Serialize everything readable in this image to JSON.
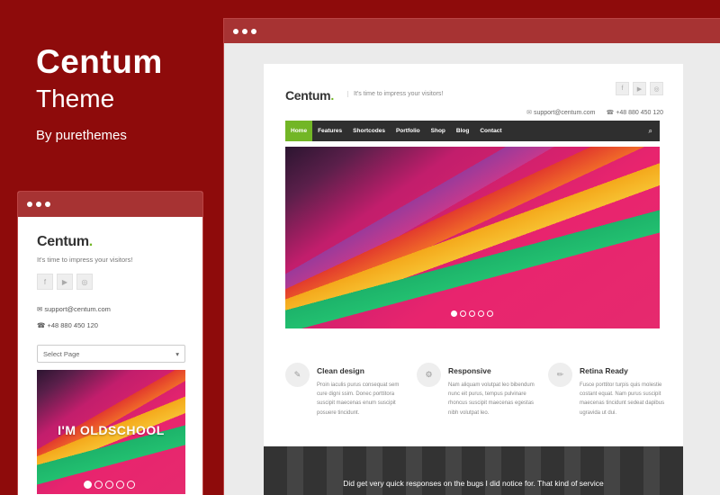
{
  "promo": {
    "title": "Centum",
    "subtitle": "Theme",
    "byline": "By purethemes"
  },
  "desktop": {
    "logo": "Centum",
    "logo_dot": ".",
    "tagline": "It's time to impress your visitors!",
    "social": [
      "f",
      "▶",
      "◎"
    ],
    "email": "support@centum.com",
    "phone": "+48 880 450 120",
    "nav": {
      "items": [
        {
          "label": "Home",
          "active": true
        },
        {
          "label": "Features"
        },
        {
          "label": "Shortcodes"
        },
        {
          "label": "Portfolio"
        },
        {
          "label": "Shop"
        },
        {
          "label": "Blog"
        },
        {
          "label": "Contact"
        }
      ],
      "search_icon": "⌕"
    },
    "slider": {
      "dots": 5,
      "active_dot": 0
    },
    "features": [
      {
        "icon": "✎",
        "title": "Clean design",
        "desc": "Proin iaculis purus consequat sem cure digni ssim. Donec porttitora suscipit maecenas enum suscipit posuere tincidunt."
      },
      {
        "icon": "⚙",
        "title": "Responsive",
        "desc": "Nam aliquam volutpat leo bibendum nunc eit purus, tempus pulvinare rhoncus suscipit maecenas egestas nibh volutpat leo."
      },
      {
        "icon": "✏",
        "title": "Retina Ready",
        "desc": "Fusce porttitor turpis quis molestie costant equat. Nam purus suscipit maecenas tincidunt sedeat dapibus ugravida ut dui."
      }
    ],
    "testimonial": "Did get very quick responses on the bugs I did notice for. That kind of service"
  },
  "mobile": {
    "logo": "Centum",
    "logo_dot": ".",
    "tagline": "It's time to impress your visitors!",
    "social": [
      "f",
      "▶",
      "◎"
    ],
    "email": "support@centum.com",
    "phone": "+48 880 450 120",
    "select_placeholder": "Select Page",
    "slider_caption": "I'M OLDSCHOOL",
    "slider": {
      "dots": 5,
      "active_dot": 0
    }
  },
  "icons": {
    "envelope": "✉",
    "phone": "☎",
    "chevron": "▾"
  }
}
